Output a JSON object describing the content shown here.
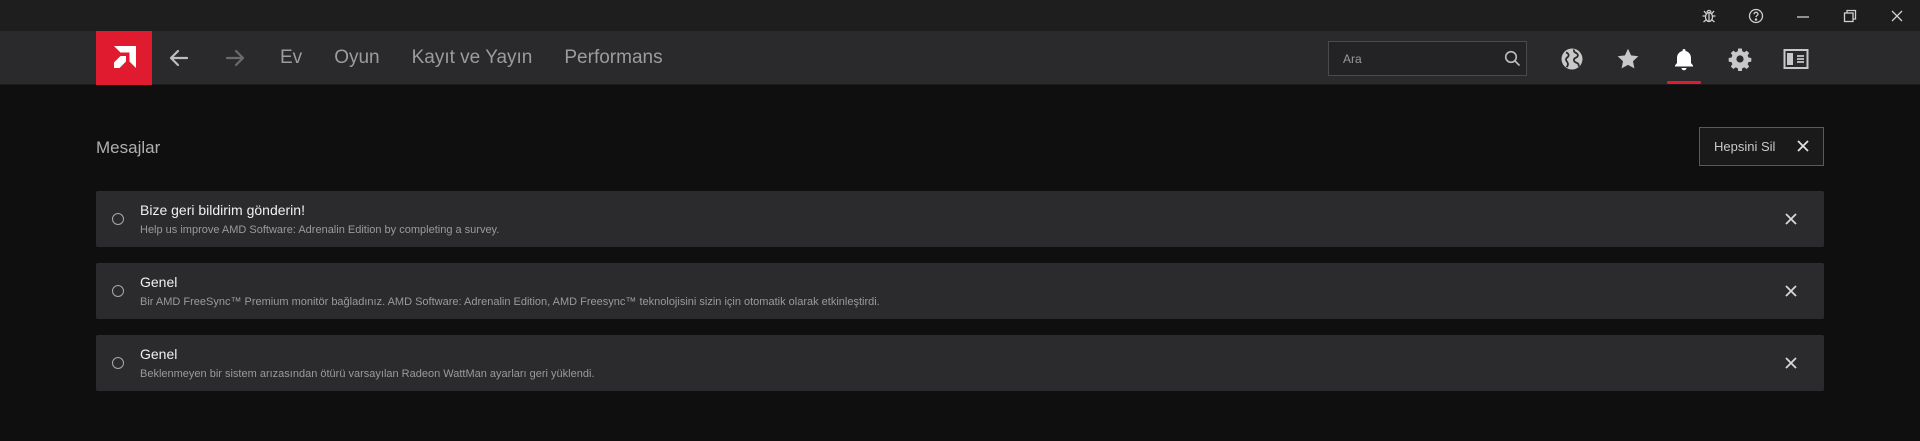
{
  "nav": {
    "links": [
      "Ev",
      "Oyun",
      "Kayıt ve Yayın",
      "Performans"
    ],
    "search_placeholder": "Ara"
  },
  "main": {
    "section_title": "Mesajlar",
    "clear_all_label": "Hepsini Sil",
    "messages": [
      {
        "title": "Bize geri bildirim gönderin!",
        "body": "Help us improve AMD Software: Adrenalin Edition by completing a survey."
      },
      {
        "title": "Genel",
        "body": "Bir AMD FreeSync™ Premium monitör bağladınız. AMD Software: Adrenalin Edition, AMD Freesync™ teknolojisini sizin için otomatik olarak etkinleştirdi."
      },
      {
        "title": "Genel",
        "body": "Beklenmeyen bir sistem arızasından ötürü varsayılan Radeon WattMan ayarları geri yüklendi."
      }
    ]
  },
  "icons": {
    "titlebar": [
      "bug-icon",
      "help-icon",
      "minimize-icon",
      "restore-icon",
      "close-icon"
    ],
    "nav": [
      "globe-icon",
      "star-icon",
      "bell-icon",
      "gear-icon",
      "sidebar-toggle-icon"
    ]
  },
  "colors": {
    "accent": "#e01b30",
    "background": "#0f0f10",
    "navbar": "#2a2a2c",
    "card": "#2b2b2d"
  }
}
